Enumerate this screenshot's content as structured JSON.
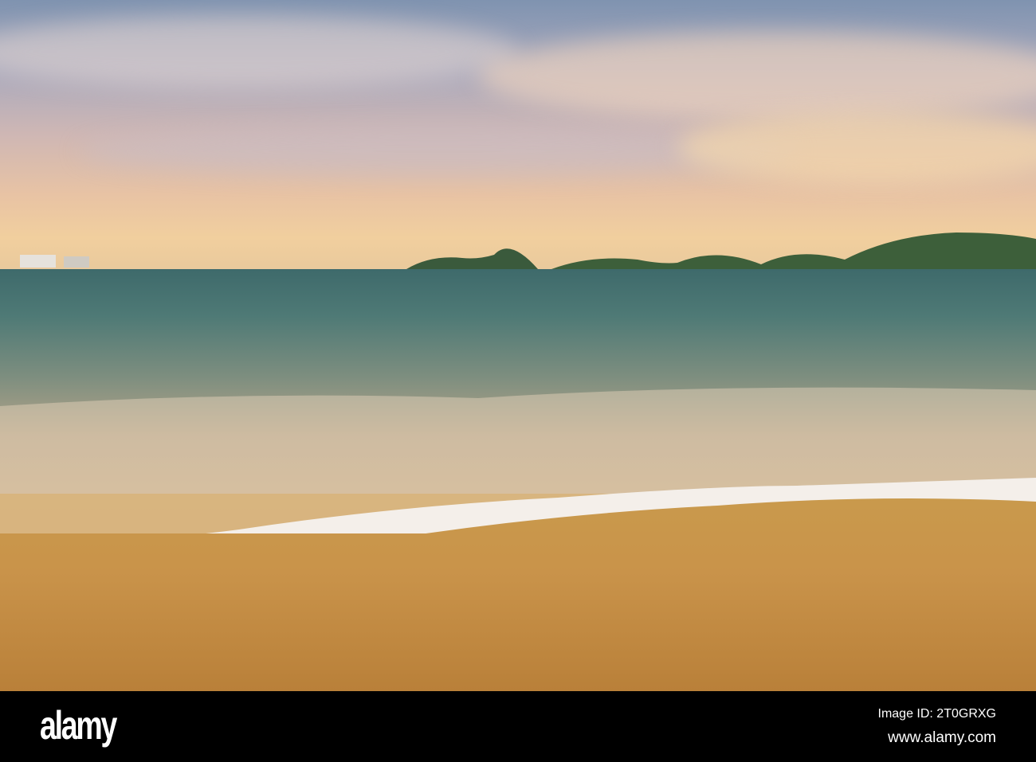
{
  "watermark": {
    "logo": "alamy",
    "image_id": "Image ID: 2T0GRXG",
    "url": "www.alamy.com"
  },
  "colors": {
    "sky": "#cfb7b4",
    "sea": "#4f7a76",
    "sand": "#c9934a",
    "foam": "#f4efea"
  }
}
